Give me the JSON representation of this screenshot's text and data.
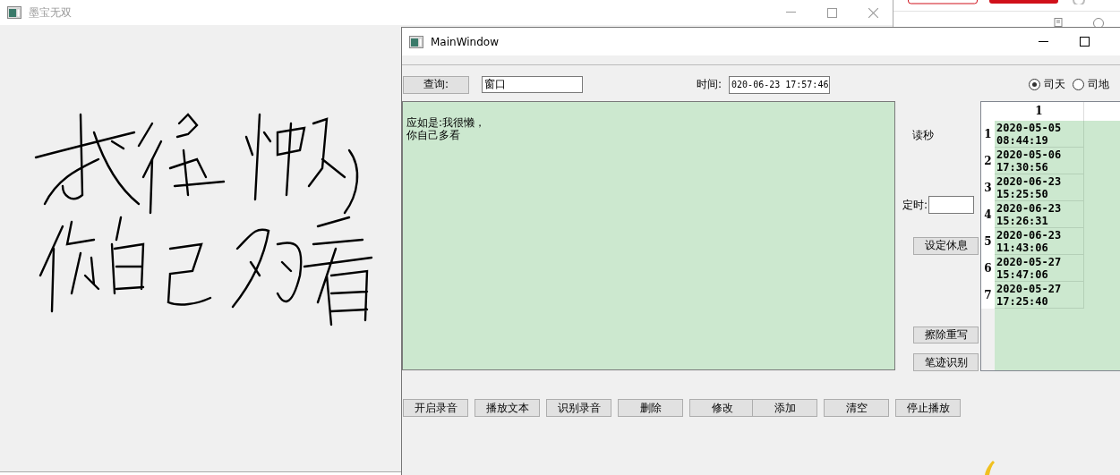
{
  "handwriting_window": {
    "title": "墨宝无双"
  },
  "main_window": {
    "title": "MainWindow",
    "query_button": "查询:",
    "query_field": "窗口",
    "time_label": "时间:",
    "time_field": "020-06-23 17:57:46",
    "radios": [
      {
        "label": "司天",
        "selected": true
      },
      {
        "label": "司地",
        "selected": false
      }
    ],
    "text_area": [
      "应如是:我很懒，",
      "你自己多看"
    ],
    "seconds_label": "读秒",
    "timer_label": "定时:",
    "side_buttons": [
      "设定休息",
      "擦除重写",
      "笔迹识别"
    ],
    "table": {
      "columns": [
        "1"
      ],
      "rows": [
        {
          "header": "1",
          "cells": [
            "2020-05-05 08:44:19"
          ]
        },
        {
          "header": "2",
          "cells": [
            "2020-05-06 17:30:56"
          ]
        },
        {
          "header": "3",
          "cells": [
            "2020-06-23 15:25:50"
          ]
        },
        {
          "header": "4",
          "cells": [
            "2020-06-23 15:26:31"
          ]
        },
        {
          "header": "5",
          "cells": [
            "2020-06-23 11:43:06"
          ]
        },
        {
          "header": "6",
          "cells": [
            "2020-05-27 15:47:06"
          ]
        },
        {
          "header": "7",
          "cells": [
            "2020-05-27 17:25:40"
          ]
        }
      ]
    },
    "bottom_buttons": [
      "开启录音",
      "播放文本",
      "识别录音",
      "删除",
      "修改",
      "添加",
      "清空",
      "停止播放"
    ]
  }
}
